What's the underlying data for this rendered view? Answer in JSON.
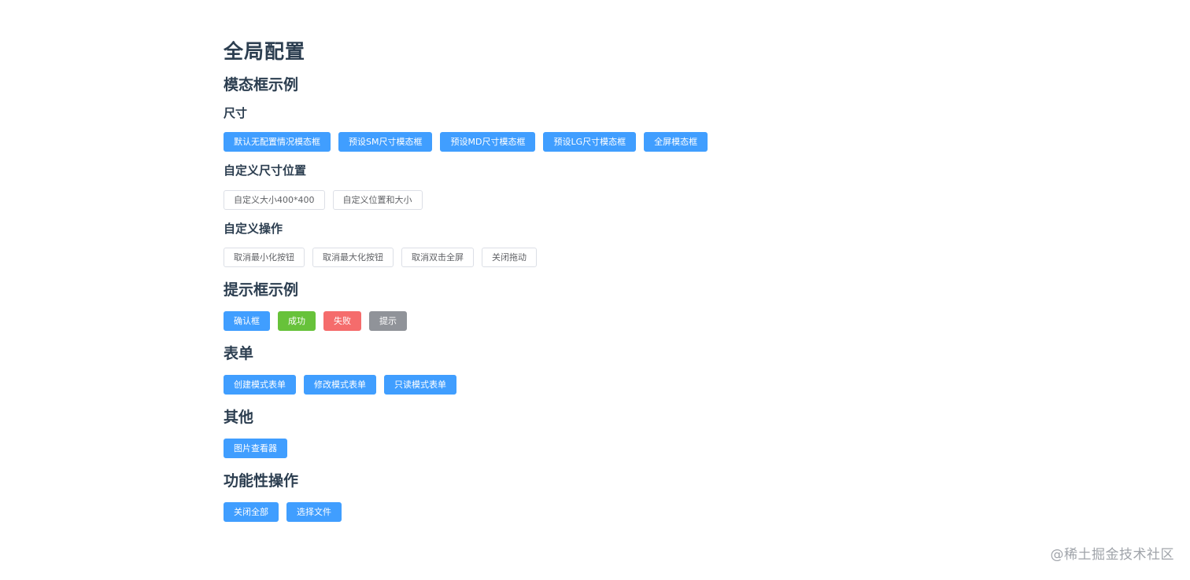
{
  "page": {
    "title": "全局配置"
  },
  "modal_section": {
    "title": "模态框示例",
    "size": {
      "title": "尺寸",
      "buttons": [
        "默认无配置情况模态框",
        "预设SM尺寸模态框",
        "预设MD尺寸模态框",
        "预设LG尺寸模态框",
        "全屏模态框"
      ]
    },
    "custom_size": {
      "title": "自定义尺寸位置",
      "buttons": [
        "自定义大小400*400",
        "自定义位置和大小"
      ]
    },
    "custom_actions": {
      "title": "自定义操作",
      "buttons": [
        "取消最小化按钮",
        "取消最大化按钮",
        "取消双击全屏",
        "关闭拖动"
      ]
    }
  },
  "prompt_section": {
    "title": "提示框示例",
    "buttons": [
      "确认框",
      "成功",
      "失败",
      "提示"
    ]
  },
  "form_section": {
    "title": "表单",
    "buttons": [
      "创建模式表单",
      "修改模式表单",
      "只读模式表单"
    ]
  },
  "other_section": {
    "title": "其他",
    "buttons": [
      "图片查看器"
    ]
  },
  "function_section": {
    "title": "功能性操作",
    "buttons": [
      "关闭全部",
      "选择文件"
    ]
  },
  "watermark": "@稀土掘金技术社区",
  "colors": {
    "primary": "#409eff",
    "success": "#67c23a",
    "danger": "#f56c6c",
    "info": "#909399",
    "heading": "#2c3e50"
  }
}
